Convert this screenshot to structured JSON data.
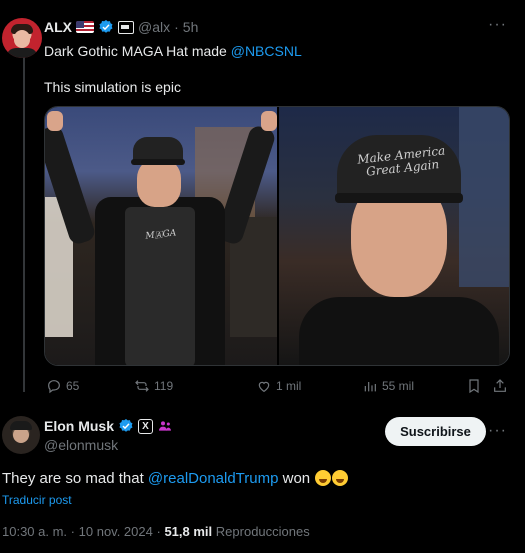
{
  "quoted_tweet": {
    "author_name": "ALX",
    "handle": "@alx",
    "separator": "·",
    "time": "5h",
    "text_prefix": "Dark Gothic MAGA Hat made ",
    "mention": "@NBCSNL",
    "text_line2": "This simulation is epic",
    "media_hat_text_left": "M🇦GA",
    "media_hat_text_right": "Make America Great Again",
    "actions": {
      "replies": "65",
      "reposts": "119",
      "likes": "1 mil",
      "views": "55 mil"
    },
    "more_label": "···"
  },
  "main_tweet": {
    "author_name": "Elon Musk",
    "handle": "@elonmusk",
    "subscribe_label": "Suscribirse",
    "more_label": "···",
    "x_badge": "X",
    "text_prefix": "They are so mad that ",
    "mention": "@realDonaldTrump",
    "text_suffix": " won ",
    "translate_label": "Traducir post",
    "time": "10:30 a. m.",
    "dot": "·",
    "date": "10 nov. 2024",
    "views_count": "51,8 mil",
    "views_label": "Reproducciones"
  },
  "colors": {
    "background": "#000000",
    "text": "#e7e9ea",
    "muted": "#71767b",
    "link": "#1d9bf0",
    "verified": "#1d9bf0",
    "subscribe_bg": "#eff3f4"
  }
}
